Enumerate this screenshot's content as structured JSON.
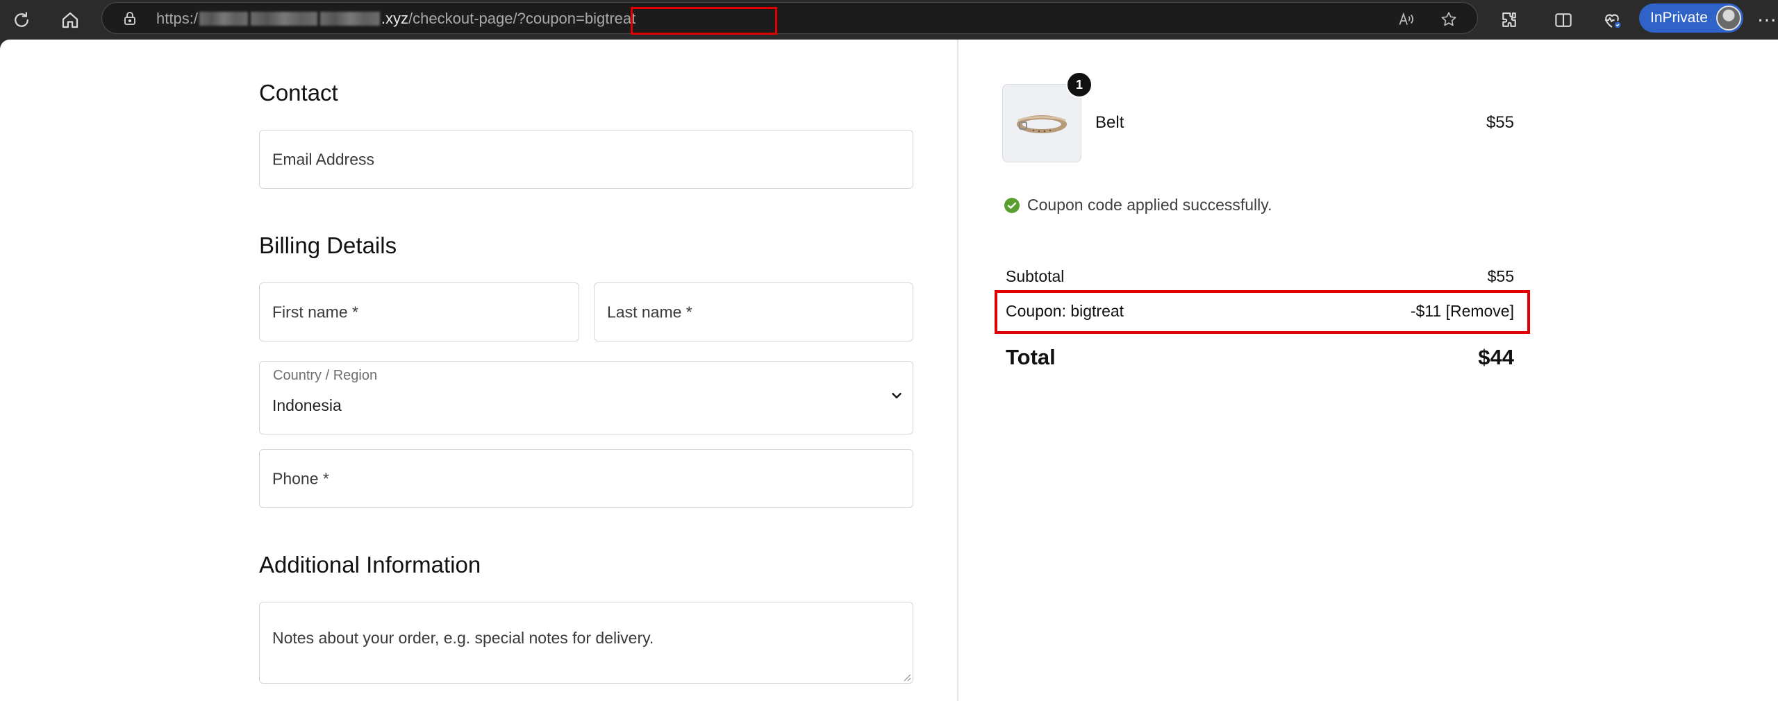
{
  "browser": {
    "url_prefix": "https:/",
    "url_domain_suffix": ".xyz",
    "url_path": "/checkout-page",
    "url_query": "/?coupon=bigtreat",
    "inprivate_label": "InPrivate",
    "icons": {
      "refresh": "refresh-icon",
      "home": "home-icon",
      "lock": "lock-icon",
      "read_aloud": "read-aloud-icon",
      "favorite": "star-icon",
      "extensions": "puzzle-icon",
      "split_screen": "split-screen-icon",
      "browser_essentials": "heart-pulse-icon",
      "profile": "avatar",
      "more": "more-icon"
    },
    "highlight_color": "#e00000"
  },
  "checkout": {
    "contact": {
      "title": "Contact",
      "email_placeholder": "Email Address"
    },
    "billing": {
      "title": "Billing Details",
      "first_name_placeholder": "First name *",
      "last_name_placeholder": "Last name *",
      "country_label": "Country / Region",
      "country_value": "Indonesia",
      "phone_placeholder": "Phone *"
    },
    "additional": {
      "title": "Additional Information",
      "notes_placeholder": "Notes about your order, e.g. special notes for delivery."
    }
  },
  "summary": {
    "item": {
      "name": "Belt",
      "price": "$55",
      "quantity": "1"
    },
    "coupon_message": "Coupon code applied successfully.",
    "subtotal_label": "Subtotal",
    "subtotal_value": "$55",
    "coupon_label": "Coupon: bigtreat",
    "coupon_discount": "-$11",
    "coupon_remove": "[Remove]",
    "total_label": "Total",
    "total_value": "$44",
    "success_color": "#5a9e2f"
  }
}
